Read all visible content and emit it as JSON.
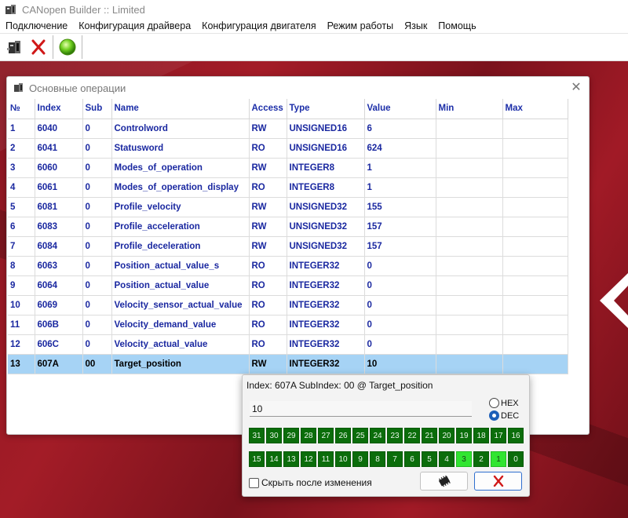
{
  "window": {
    "title": "CANopen Builder :: Limited"
  },
  "menu": [
    "Подключение",
    "Конфигурация драйвера",
    "Конфигурация двигателя",
    "Режим работы",
    "Язык",
    "Помощь"
  ],
  "inner_window": {
    "title": "Основные операции"
  },
  "table": {
    "columns": [
      "№",
      "Index",
      "Sub",
      "Name",
      "Access",
      "Type",
      "Value",
      "Min",
      "Max"
    ],
    "rows": [
      [
        "1",
        "6040",
        "0",
        "Controlword",
        "RW",
        "UNSIGNED16",
        "6",
        "",
        ""
      ],
      [
        "2",
        "6041",
        "0",
        "Statusword",
        "RO",
        "UNSIGNED16",
        "624",
        "",
        ""
      ],
      [
        "3",
        "6060",
        "0",
        "Modes_of_operation",
        "RW",
        "INTEGER8",
        "1",
        "",
        ""
      ],
      [
        "4",
        "6061",
        "0",
        "Modes_of_operation_display",
        "RO",
        "INTEGER8",
        "1",
        "",
        ""
      ],
      [
        "5",
        "6081",
        "0",
        "Profile_velocity",
        "RW",
        "UNSIGNED32",
        "155",
        "",
        ""
      ],
      [
        "6",
        "6083",
        "0",
        "Profile_acceleration",
        "RW",
        "UNSIGNED32",
        "157",
        "",
        ""
      ],
      [
        "7",
        "6084",
        "0",
        "Profile_deceleration",
        "RW",
        "UNSIGNED32",
        "157",
        "",
        ""
      ],
      [
        "8",
        "6063",
        "0",
        "Position_actual_value_s",
        "RO",
        "INTEGER32",
        "0",
        "",
        ""
      ],
      [
        "9",
        "6064",
        "0",
        "Position_actual_value",
        "RO",
        "INTEGER32",
        "0",
        "",
        ""
      ],
      [
        "10",
        "6069",
        "0",
        "Velocity_sensor_actual_value",
        "RO",
        "INTEGER32",
        "0",
        "",
        ""
      ],
      [
        "11",
        "606B",
        "0",
        "Velocity_demand_value",
        "RO",
        "INTEGER32",
        "0",
        "",
        ""
      ],
      [
        "12",
        "606C",
        "0",
        "Velocity_actual_value",
        "RO",
        "INTEGER32",
        "0",
        "",
        ""
      ],
      [
        "13",
        "607A",
        "00",
        "Target_position",
        "RW",
        "INTEGER32",
        "10",
        "",
        ""
      ]
    ],
    "selected_row": 12
  },
  "bit_dialog": {
    "title": "Index: 607A SubIndex: 00 @ Target_position",
    "value": "10",
    "radio_hex": "HEX",
    "radio_dec": "DEC",
    "selected_format": "DEC",
    "bits_high": [
      "31",
      "30",
      "29",
      "28",
      "27",
      "26",
      "25",
      "24",
      "23",
      "22",
      "21",
      "20",
      "19",
      "18",
      "17",
      "16"
    ],
    "bits_low": [
      "15",
      "14",
      "13",
      "12",
      "11",
      "10",
      "9",
      "8",
      "7",
      "6",
      "5",
      "4",
      "3",
      "2",
      "1",
      "0"
    ],
    "set_bits": [
      "3",
      "1"
    ],
    "hide_after_change": "Скрыть после изменения",
    "hide_after_change_checked": false
  },
  "colors": {
    "header_text": "#1c2ea8",
    "row_text": "#1a28a0",
    "selected_row": "#a6d3f5",
    "bit_off": "#0b6d0b",
    "bit_on": "#31e531",
    "desktop": "#8a1621"
  }
}
